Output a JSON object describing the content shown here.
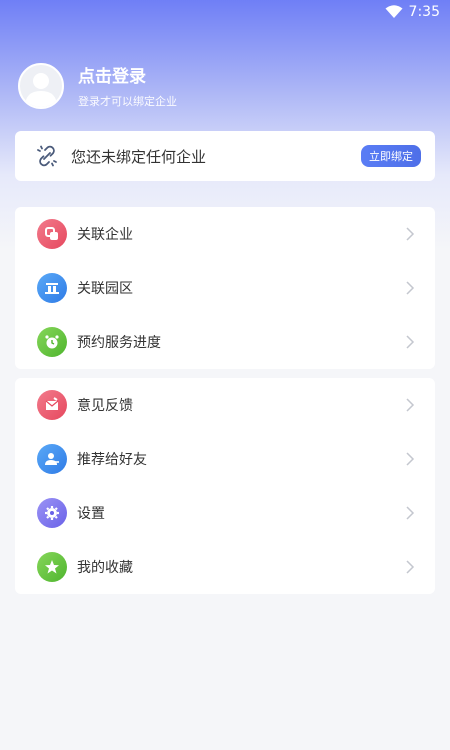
{
  "status_bar": {
    "time": "7:35"
  },
  "profile": {
    "title": "点击登录",
    "subtitle": "登录才可以绑定企业"
  },
  "bind_card": {
    "text": "您还未绑定任何企业",
    "button": "立即绑定"
  },
  "menu_group_1": [
    {
      "label": "关联企业",
      "icon": "link-enterprise-icon",
      "color": "#ec5b72"
    },
    {
      "label": "关联园区",
      "icon": "park-icon",
      "color": "#3d8ef0"
    },
    {
      "label": "预约服务进度",
      "icon": "alarm-clock-icon",
      "color": "#5fc43b"
    }
  ],
  "menu_group_2": [
    {
      "label": "意见反馈",
      "icon": "feedback-icon",
      "color": "#ec5b72"
    },
    {
      "label": "推荐给好友",
      "icon": "recommend-user-icon",
      "color": "#3d8ef0"
    },
    {
      "label": "设置",
      "icon": "settings-gear-icon",
      "color": "#7b74f0"
    },
    {
      "label": "我的收藏",
      "icon": "star-icon",
      "color": "#5fc43b"
    }
  ]
}
